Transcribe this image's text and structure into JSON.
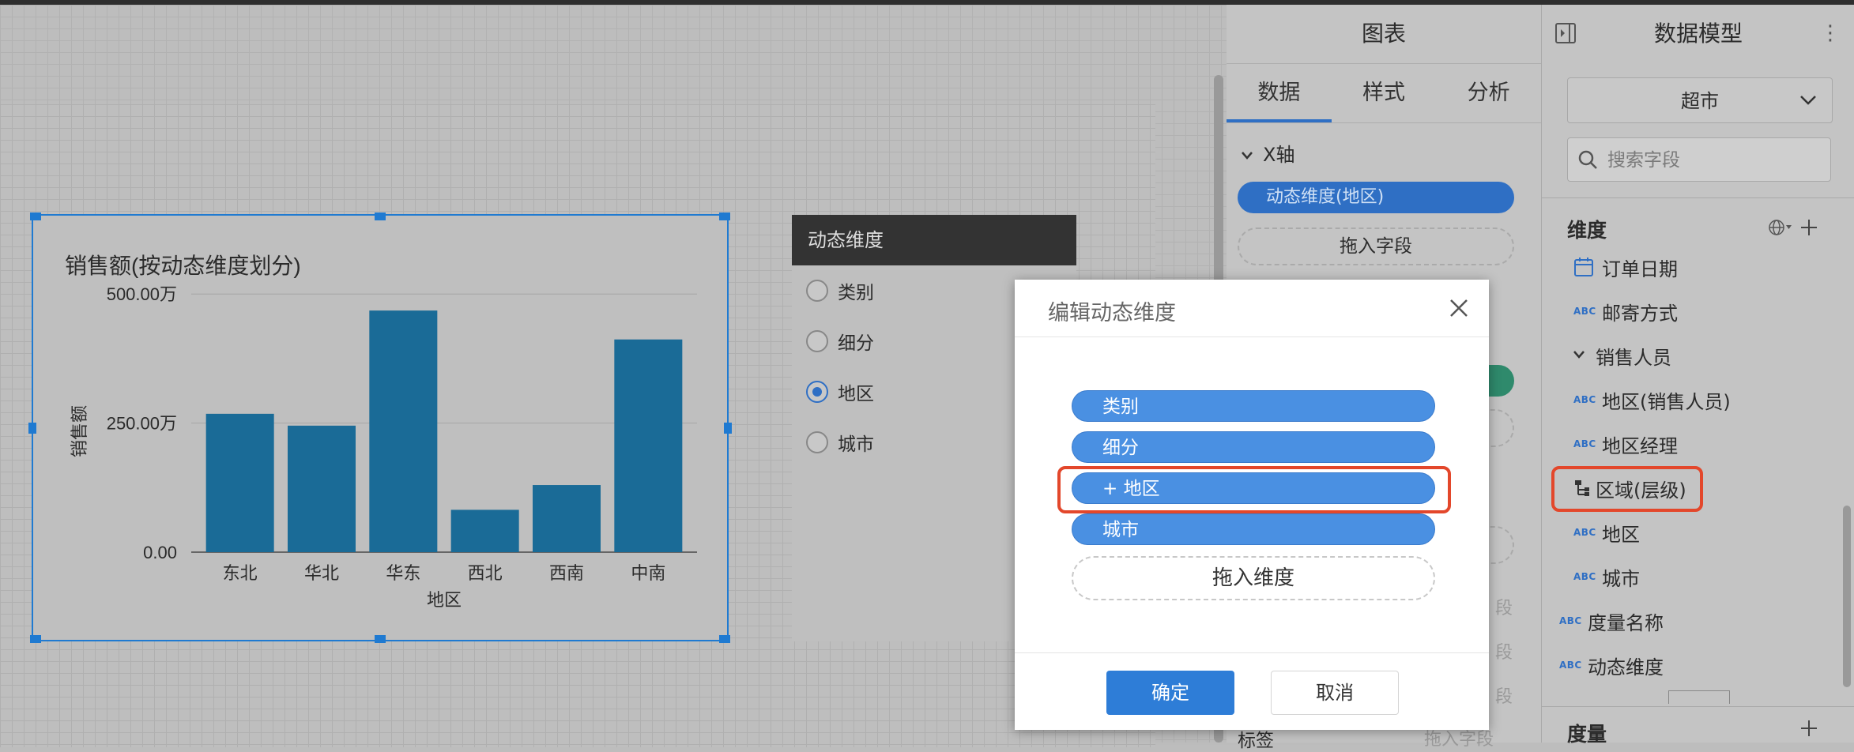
{
  "canvas": {
    "chart_widget": {
      "title": "销售额(按动态维度划分)"
    },
    "filter_widget": {
      "header": "动态维度",
      "options": [
        {
          "label": "类别",
          "checked": false
        },
        {
          "label": "细分",
          "checked": false
        },
        {
          "label": "地区",
          "checked": true
        },
        {
          "label": "城市",
          "checked": false
        }
      ]
    }
  },
  "chart_data": {
    "type": "bar",
    "title": "销售额(按动态维度划分)",
    "xlabel": "地区",
    "ylabel": "销售额",
    "categories": [
      "东北",
      "华北",
      "华东",
      "西北",
      "西南",
      "中南"
    ],
    "values": [
      268,
      245,
      468,
      82,
      130,
      412
    ],
    "ylim": [
      0,
      560
    ],
    "yticks": [
      {
        "value": 0,
        "label": "0.00"
      },
      {
        "value": 250,
        "label": "250.00万"
      },
      {
        "value": 500,
        "label": "500.00万"
      }
    ],
    "grid": true,
    "color": "#1a6b97"
  },
  "chart_panel": {
    "title": "图表",
    "tabs": [
      {
        "label": "数据",
        "active": true
      },
      {
        "label": "样式",
        "active": false
      },
      {
        "label": "分析",
        "active": false
      }
    ],
    "x_axis": {
      "label": "X轴",
      "field": "动态维度(地区)",
      "drop_hint": "拖入字段"
    },
    "ghost": {
      "drop_1": "段",
      "drop_2": "段",
      "drop_3": "段",
      "label_row": "标签",
      "label_drop": "拖入字段"
    }
  },
  "model_panel": {
    "title": "数据模型",
    "dataset": "超市",
    "search_placeholder": "搜索字段",
    "dimensions_label": "维度",
    "fields": [
      {
        "label": "订单日期",
        "type": "date-icon"
      },
      {
        "label": "邮寄方式",
        "type": "ABC"
      },
      {
        "label": "销售人员",
        "type": "folder"
      },
      {
        "label": "地区(销售人员)",
        "type": "ABC"
      },
      {
        "label": "地区经理",
        "type": "ABC"
      },
      {
        "label": "区域(层级)",
        "type": "hierarchy-icon"
      },
      {
        "label": "地区",
        "type": "ABC"
      },
      {
        "label": "城市",
        "type": "ABC"
      },
      {
        "label": "度量名称",
        "type": "ABC"
      },
      {
        "label": "动态维度",
        "type": "ABC"
      }
    ],
    "measures_label": "度量"
  },
  "dialog": {
    "title": "编辑动态维度",
    "items": [
      {
        "label": "类别"
      },
      {
        "label": "细分"
      },
      {
        "label": "+ 地区"
      },
      {
        "label": "城市"
      }
    ],
    "drop_hint": "拖入维度",
    "ok_label": "确定",
    "cancel_label": "取消"
  },
  "colors": {
    "accent": "#2f6fc4",
    "highlight": "#e3472b",
    "primary_button": "#2e7dd7",
    "dialog_pill": "#4a90e2"
  }
}
